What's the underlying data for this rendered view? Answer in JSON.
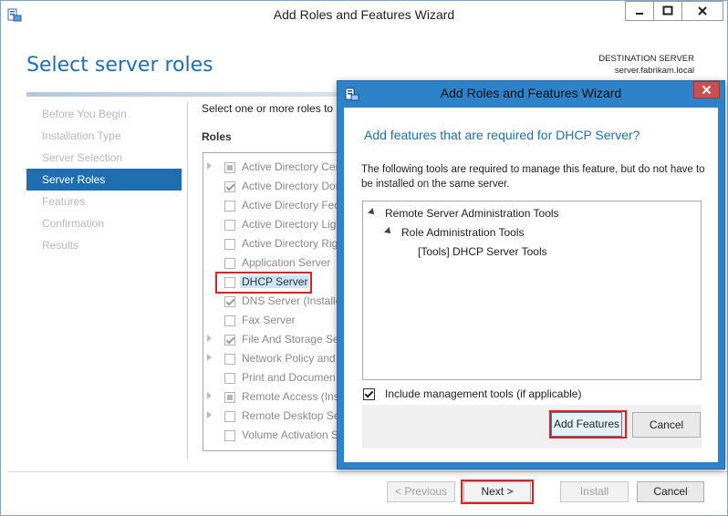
{
  "main_window": {
    "title": "Add Roles and Features Wizard",
    "page_title": "Select server roles",
    "destination_label": "DESTINATION SERVER",
    "destination_server": "server.fabrikam.local",
    "nav": [
      {
        "label": "Before You Begin",
        "active": false
      },
      {
        "label": "Installation Type",
        "active": false
      },
      {
        "label": "Server Selection",
        "active": false
      },
      {
        "label": "Server Roles",
        "active": true
      },
      {
        "label": "Features",
        "active": false
      },
      {
        "label": "Confirmation",
        "active": false
      },
      {
        "label": "Results",
        "active": false
      }
    ],
    "intro_text": "Select one or more roles to",
    "roles_header": "Roles",
    "roles": [
      {
        "label": "Active Directory Cer",
        "state": "partial",
        "expandable": true
      },
      {
        "label": "Active Directory Dor",
        "state": "checked",
        "expandable": false
      },
      {
        "label": "Active Directory Fed",
        "state": "unchecked",
        "expandable": false
      },
      {
        "label": "Active Directory Lig",
        "state": "unchecked",
        "expandable": false
      },
      {
        "label": "Active Directory Rig",
        "state": "unchecked",
        "expandable": false
      },
      {
        "label": "Application Server",
        "state": "unchecked",
        "expandable": false
      },
      {
        "label": "DHCP Server",
        "state": "unchecked",
        "expandable": false,
        "selected": true
      },
      {
        "label": "DNS Server (Installe",
        "state": "checked",
        "expandable": false
      },
      {
        "label": "Fax Server",
        "state": "unchecked",
        "expandable": false
      },
      {
        "label": "File And Storage Se",
        "state": "checked",
        "expandable": true
      },
      {
        "label": "Network Policy and",
        "state": "unchecked",
        "expandable": true
      },
      {
        "label": "Print and Documen",
        "state": "unchecked",
        "expandable": false
      },
      {
        "label": "Remote Access (Inst",
        "state": "partial",
        "expandable": true
      },
      {
        "label": "Remote Desktop Se",
        "state": "unchecked",
        "expandable": true
      },
      {
        "label": "Volume Activation S",
        "state": "unchecked",
        "expandable": false
      }
    ],
    "buttons": {
      "previous": "< Previous",
      "next": "Next >",
      "install": "Install",
      "cancel": "Cancel"
    }
  },
  "dialog": {
    "title": "Add Roles and Features Wizard",
    "heading": "Add features that are required for DHCP Server?",
    "description": "The following tools are required to manage this feature, but do not have to be installed on the same server.",
    "tree": [
      {
        "label": "Remote Server Administration Tools",
        "level": 0,
        "expanded": true
      },
      {
        "label": "Role Administration Tools",
        "level": 1,
        "expanded": true
      },
      {
        "label": "[Tools] DHCP Server Tools",
        "level": 2,
        "expanded": false
      }
    ],
    "include_mgmt_label": "Include management tools (if applicable)",
    "include_mgmt_checked": true,
    "add_features_label": "Add Features",
    "cancel_label": "Cancel"
  },
  "colors": {
    "accent": "#1f6fb0",
    "highlight": "#e02020",
    "dialog_frame": "#2e82c8"
  }
}
